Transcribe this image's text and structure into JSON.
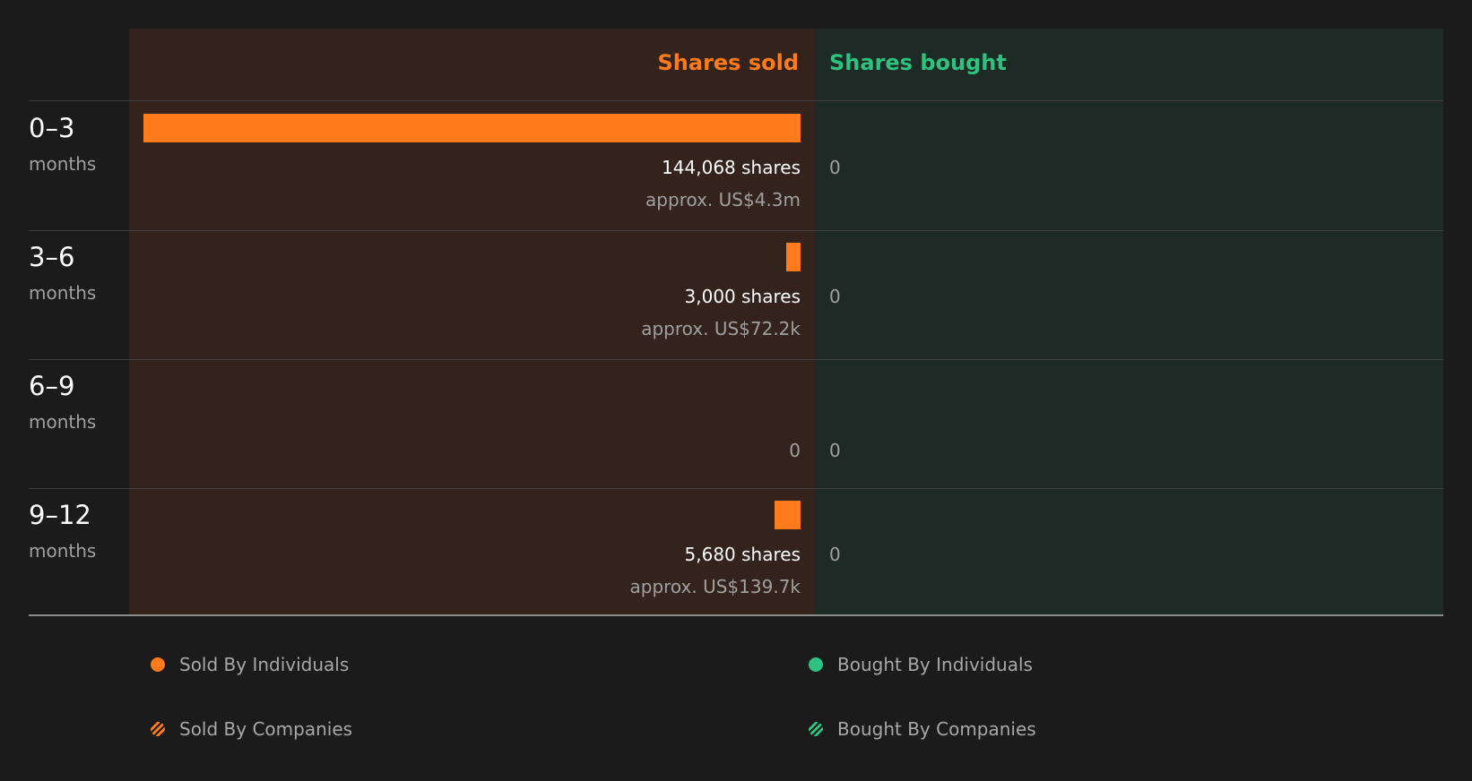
{
  "chart_data": {
    "type": "bar",
    "headers": {
      "sold": "Shares sold",
      "bought": "Shares bought"
    },
    "categories": [
      {
        "period": "0–3",
        "unit": "months"
      },
      {
        "period": "3–6",
        "unit": "months"
      },
      {
        "period": "6–9",
        "unit": "months"
      },
      {
        "period": "9–12",
        "unit": "months"
      }
    ],
    "series": [
      {
        "name": "Shares sold",
        "values": [
          144068,
          3000,
          0,
          5680
        ],
        "labels": [
          "144,068 shares",
          "3,000 shares",
          "0",
          "5,680 shares"
        ],
        "approx": [
          "approx. US$4.3m",
          "approx. US$72.2k",
          "",
          "approx. US$139.7k"
        ]
      },
      {
        "name": "Shares bought",
        "values": [
          0,
          0,
          0,
          0
        ],
        "labels": [
          "0",
          "0",
          "0",
          "0"
        ]
      }
    ],
    "legend": [
      {
        "label": "Sold By Individuals",
        "color": "#ff7a1a",
        "style": "solid"
      },
      {
        "label": "Bought By Individuals",
        "color": "#2ec27e",
        "style": "solid"
      },
      {
        "label": "Sold By Companies",
        "color": "#ff7a1a",
        "style": "hatched"
      },
      {
        "label": "Bought By Companies",
        "color": "#2ec27e",
        "style": "hatched"
      }
    ],
    "colors": {
      "sold": "#ff7a1a",
      "bought": "#2ec27e"
    }
  }
}
